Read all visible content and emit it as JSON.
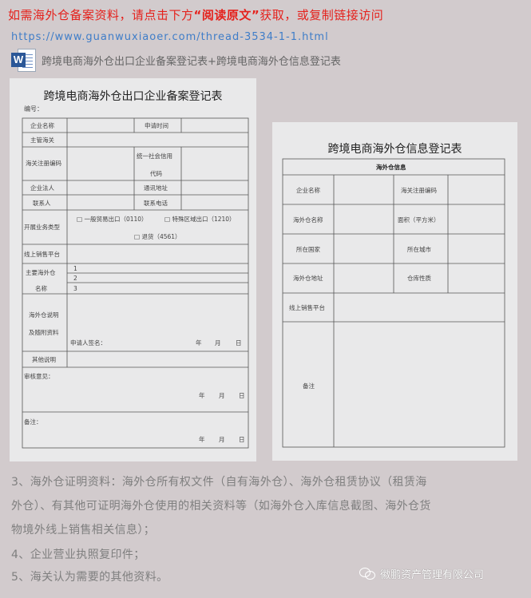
{
  "notice": {
    "prefix": "如需海外仓备案资料，请点击下方",
    "quoted": "“阅读原文”",
    "suffix": "获取，或复制链接访问"
  },
  "link": "https://www.guanwuxiaoer.com/thread-3534-1-1.html",
  "doc_line": {
    "icon": "word-document-icon",
    "title": "跨境电商海外仓出口企业备案登记表+跨境电商海外仓信息登记表"
  },
  "form1": {
    "title": "跨境电商海外仓出口企业备案登记表",
    "number_label": "编号：",
    "cells": {
      "company_name": "企业名称",
      "apply_time": "申请时间",
      "customs": "主管海关",
      "customs_code": "海关注册编码",
      "credit_code_1": "统一社会信用",
      "credit_code_2": "代码",
      "legal_rep": "企业法人",
      "address": "通讯地址",
      "contact": "联系人",
      "phone": "联系电话",
      "business_type": "开展业务类型",
      "opt1": "□ 一般贸易出口（0110）",
      "opt2": "□ 特殊区域出口（1210）",
      "opt3": "□ 退货（4561）",
      "online_platform": "线上销售平台",
      "main_wh_1": "主要海外仓",
      "main_wh_2": "名称",
      "n1": "1",
      "n2": "2",
      "n3": "3",
      "proof_1": "海外仓说明",
      "proof_2": "及随附资料",
      "signature": "申请人签名：",
      "year": "年",
      "month": "月",
      "day": "日",
      "other": "其他说明",
      "review": "审核意见：",
      "remark": "备注："
    }
  },
  "form2": {
    "title": "跨境电商海外仓信息登记表",
    "cells": {
      "header": "海外仓信息",
      "company_name": "企业名称",
      "customs_code": "海关注册编码",
      "wh_name": "海外仓名称",
      "area": "面积（平方米）",
      "country": "所在国家",
      "city": "所在城市",
      "wh_address": "海外仓地址",
      "wh_nature": "仓库性质",
      "online_platform": "线上销售平台",
      "remark": "备注"
    }
  },
  "body": [
    "3、海外仓证明资料：海外仓所有权文件（自有海外仓）、海外仓租赁协议（租赁海",
    "外仓）、有其他可证明海外仓使用的相关资料等（如海外仓入库信息截图、海外仓货",
    "物境外线上销售相关信息）；",
    "4、企业营业执照复印件；",
    "5、海关认为需要的其他资料。"
  ],
  "watermark": {
    "icon": "wechat-icon",
    "text": "徽鹏资产管理有限公司"
  }
}
